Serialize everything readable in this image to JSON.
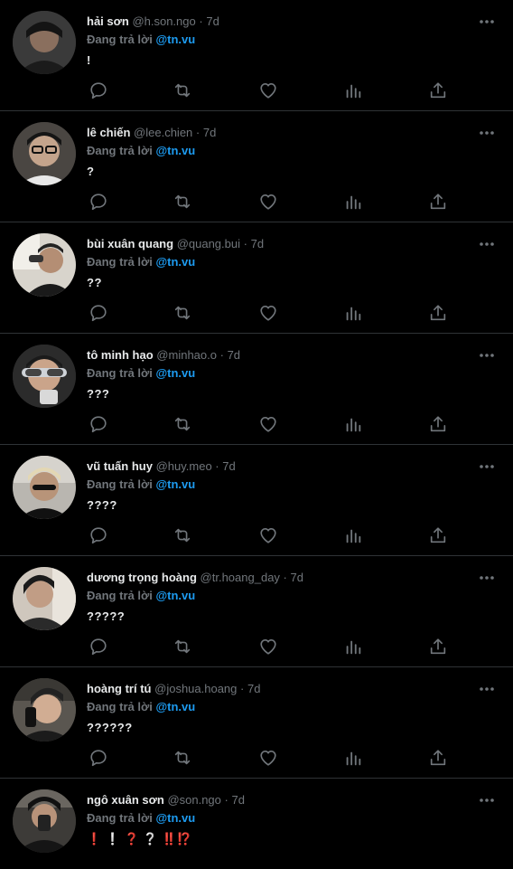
{
  "meta": {
    "reply_prefix": "Đang trả lời",
    "separator": "·",
    "accent": "#1d9bf0",
    "text_muted": "#71767b",
    "background": "#000000"
  },
  "tweets": [
    {
      "name": "hải sơn",
      "handle": "@h.son.ngo",
      "time": "7d",
      "reply_to": "@tn.vu",
      "text": "!"
    },
    {
      "name": "lê chiến",
      "handle": "@lee.chien",
      "time": "7d",
      "reply_to": "@tn.vu",
      "text": "?"
    },
    {
      "name": "bùi xuân quang",
      "handle": "@quang.bui",
      "time": "7d",
      "reply_to": "@tn.vu",
      "text": "??"
    },
    {
      "name": "tô minh hạo",
      "handle": "@minhao.o",
      "time": "7d",
      "reply_to": "@tn.vu",
      "text": "???"
    },
    {
      "name": "vũ tuấn huy",
      "handle": "@huy.meo",
      "time": "7d",
      "reply_to": "@tn.vu",
      "text": "????"
    },
    {
      "name": "dương trọng hoàng",
      "handle": "@tr.hoang_day",
      "time": "7d",
      "reply_to": "@tn.vu",
      "text": "?????"
    },
    {
      "name": "hoàng trí tú",
      "handle": "@joshua.hoang",
      "time": "7d",
      "reply_to": "@tn.vu",
      "text": "??????"
    },
    {
      "name": "ngô xuân sơn",
      "handle": "@son.ngo",
      "time": "7d",
      "reply_to": "@tn.vu",
      "text": "❗ ❕ ❓ ❔ ‼️⁉️"
    }
  ],
  "icons": {
    "reply": "reply-icon",
    "retweet": "retweet-icon",
    "like": "heart-icon",
    "views": "views-chart-icon",
    "share": "share-icon",
    "more": "more-dots-icon"
  }
}
